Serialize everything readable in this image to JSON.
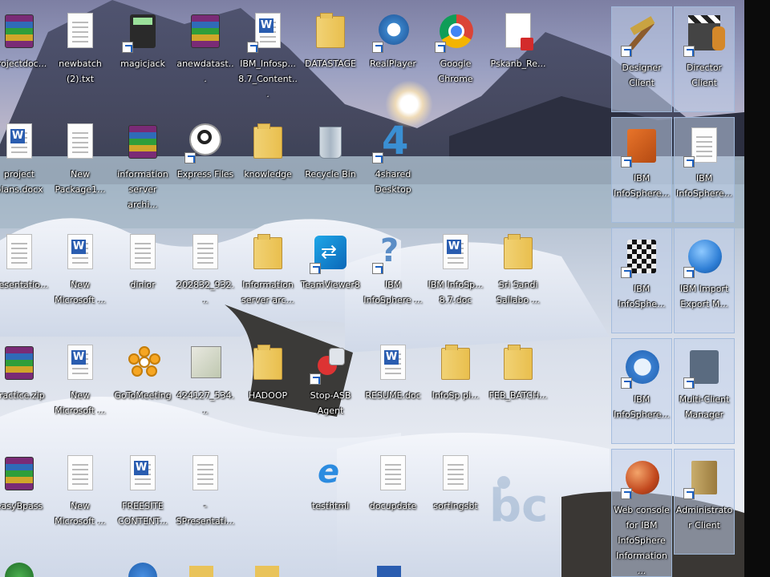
{
  "desktop": {
    "icons": [
      {
        "label": "projectdoc...",
        "kind": "rar"
      },
      {
        "label": "newbatch (2).txt",
        "kind": "doc"
      },
      {
        "label": "magicjack",
        "kind": "calc"
      },
      {
        "label": "anewdatast...",
        "kind": "rar"
      },
      {
        "label": "IBM_Infosp... 8.7_Content...",
        "kind": "word"
      },
      {
        "label": "DATASTAGE",
        "kind": "folder"
      },
      {
        "label": "RealPlayer",
        "kind": "realplayer"
      },
      {
        "label": "Google Chrome",
        "kind": "chrome"
      },
      {
        "label": "Pskanb_Re...",
        "kind": "pdf"
      },
      {
        "label": "Designer Client",
        "kind": "tools"
      },
      {
        "label": "Director Client",
        "kind": "clapper"
      },
      {
        "label": "project plans.docx",
        "kind": "word"
      },
      {
        "label": "New Package1...",
        "kind": "doc"
      },
      {
        "label": "information server archi...",
        "kind": "rar"
      },
      {
        "label": "Express Files",
        "kind": "magnifier"
      },
      {
        "label": "knowledge",
        "kind": "folder"
      },
      {
        "label": "Recycle Bin",
        "kind": "bin"
      },
      {
        "label": "4shared Desktop",
        "kind": "four"
      },
      {
        "label": "IBM InfoSphere...",
        "kind": "bricks"
      },
      {
        "label": "IBM InfoSphere...",
        "kind": "doc"
      },
      {
        "label": "Presentatio...",
        "kind": "doc"
      },
      {
        "label": "New Microsoft ...",
        "kind": "word"
      },
      {
        "label": "dinior",
        "kind": "doc"
      },
      {
        "label": "202832_932...",
        "kind": "doc"
      },
      {
        "label": "Information server arc...",
        "kind": "folder"
      },
      {
        "label": "TeamViewer8",
        "kind": "teamviewer"
      },
      {
        "label": "IBM InfoSphere ...",
        "kind": "question"
      },
      {
        "label": "IBM InfoSp... 8.7.doc",
        "kind": "word"
      },
      {
        "label": "Sri Sandi Sallabo ...",
        "kind": "folder"
      },
      {
        "label": "IBM InfoSphe...",
        "kind": "checker"
      },
      {
        "label": "IBM Import Export M...",
        "kind": "ibm-ie"
      },
      {
        "label": "Practice.zip",
        "kind": "rar"
      },
      {
        "label": "New Microsoft ...",
        "kind": "word"
      },
      {
        "label": "GoToMeeting",
        "kind": "gotomeeting"
      },
      {
        "label": "424127_534...",
        "kind": "image"
      },
      {
        "label": "HADOOP",
        "kind": "folder"
      },
      {
        "label": "Stop-ASB Agent",
        "kind": "people"
      },
      {
        "label": "RESUME.doc",
        "kind": "word"
      },
      {
        "label": "InfoSp pl...",
        "kind": "folder"
      },
      {
        "label": "FEB_BATCH...",
        "kind": "folder"
      },
      {
        "label": "IBM InfoSphere...",
        "kind": "diamond"
      },
      {
        "label": "Multi-Client Manager",
        "kind": "film"
      },
      {
        "label": "easyBpass",
        "kind": "rar"
      },
      {
        "label": "New Microsoft ...",
        "kind": "doc"
      },
      {
        "label": "FREESITE CONTENT...",
        "kind": "word"
      },
      {
        "label": "-SPresentati...",
        "kind": "doc"
      },
      {
        "label": "testhtml",
        "kind": "ie"
      },
      {
        "label": "docupdate",
        "kind": "doc"
      },
      {
        "label": "sortingsbt",
        "kind": "doc"
      },
      {
        "label": "Web console for IBM InfoSphere Information ...",
        "kind": "globe"
      },
      {
        "label": "Administrator Client",
        "kind": "cabinet"
      }
    ]
  },
  "watermark": {
    "text": "bc"
  },
  "colors": {
    "label_text": "#ffffff",
    "selection": "#c3d2eb",
    "right_bar": "#0b0b0b"
  }
}
